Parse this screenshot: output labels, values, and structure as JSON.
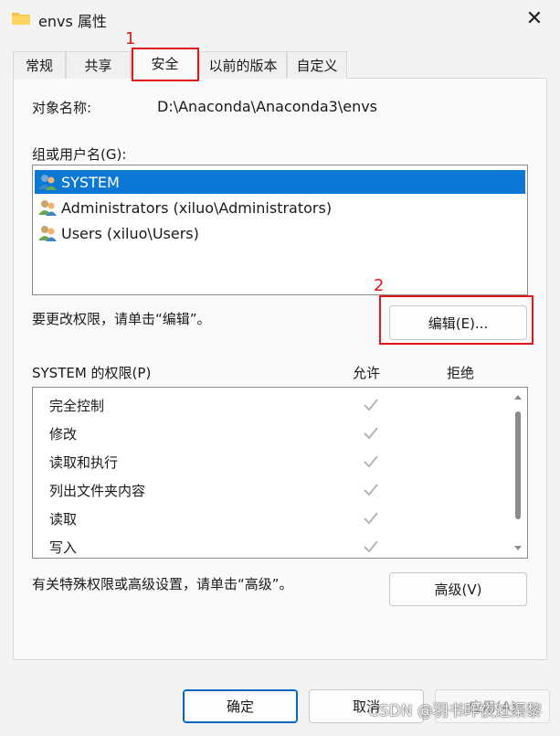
{
  "window": {
    "title": "envs 属性",
    "close_glyph": "✕"
  },
  "tabs": [
    {
      "label": "常规"
    },
    {
      "label": "共享"
    },
    {
      "label": "安全",
      "active": true
    },
    {
      "label": "以前的版本"
    },
    {
      "label": "自定义"
    }
  ],
  "object_name": {
    "label": "对象名称:",
    "value": "D:\\Anaconda\\Anaconda3\\envs"
  },
  "groups": {
    "label": "组或用户名(G):",
    "items": [
      {
        "name": "SYSTEM",
        "selected": true,
        "icon": "users-icon"
      },
      {
        "name": "Administrators (xiluo\\Administrators)",
        "selected": false,
        "icon": "users-icon"
      },
      {
        "name": "Users (xiluo\\Users)",
        "selected": false,
        "icon": "users-icon"
      }
    ]
  },
  "change_hint": "要更改权限，请单击“编辑”。",
  "edit_button": "编辑(E)...",
  "permissions": {
    "label": "SYSTEM 的权限(P)",
    "allow_header": "允许",
    "deny_header": "拒绝",
    "rows": [
      {
        "name": "完全控制",
        "allow": true,
        "deny": false
      },
      {
        "name": "修改",
        "allow": true,
        "deny": false
      },
      {
        "name": "读取和执行",
        "allow": true,
        "deny": false
      },
      {
        "name": "列出文件夹内容",
        "allow": true,
        "deny": false
      },
      {
        "name": "读取",
        "allow": true,
        "deny": false
      },
      {
        "name": "写入",
        "allow": true,
        "deny": false
      }
    ]
  },
  "advanced_hint": "有关特殊权限或高级设置，请单击“高级”。",
  "advanced_button": "高级(V)",
  "footer": {
    "ok": "确定",
    "cancel": "取消",
    "apply": "应用(A)"
  },
  "annotations": {
    "step1": "1",
    "step2": "2"
  },
  "watermark": "CSDN @羽书昨夜过渠黎",
  "colors": {
    "selection": "#0a78d4",
    "annotation": "#e0181e",
    "primary_border": "#0067c0"
  }
}
